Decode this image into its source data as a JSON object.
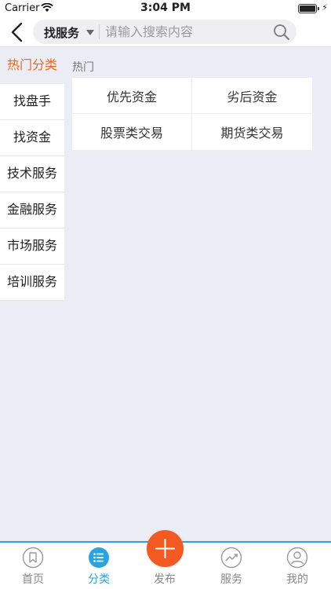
{
  "status_bar": {
    "carrier": "Carrier",
    "time": "3:04 PM"
  },
  "nav": {
    "back_icon": "chevron-left-icon",
    "scope_label": "找服务",
    "search_placeholder": "请输入搜索内容",
    "search_icon": "search-icon"
  },
  "sidebar": {
    "items": [
      {
        "label": "热门分类",
        "active": true
      },
      {
        "label": "找盘手"
      },
      {
        "label": "找资金"
      },
      {
        "label": "技术服务"
      },
      {
        "label": "金融服务"
      },
      {
        "label": "市场服务"
      },
      {
        "label": "培训服务"
      }
    ]
  },
  "main": {
    "section_title": "热门",
    "items": [
      "优先资金",
      "劣后资金",
      "股票类交易",
      "期货类交易"
    ]
  },
  "tab_bar": {
    "tabs": [
      {
        "label": "首页",
        "icon": "bookmark-icon"
      },
      {
        "label": "分类",
        "icon": "list-icon",
        "active": true
      },
      {
        "label": "发布",
        "icon": "plus-icon"
      },
      {
        "label": "服务",
        "icon": "trend-icon"
      },
      {
        "label": "我的",
        "icon": "profile-icon"
      }
    ]
  },
  "colors": {
    "accent": "#2aa3e0",
    "active_text": "#f06620",
    "publish": "#f25a21",
    "background": "#ebedf4"
  }
}
